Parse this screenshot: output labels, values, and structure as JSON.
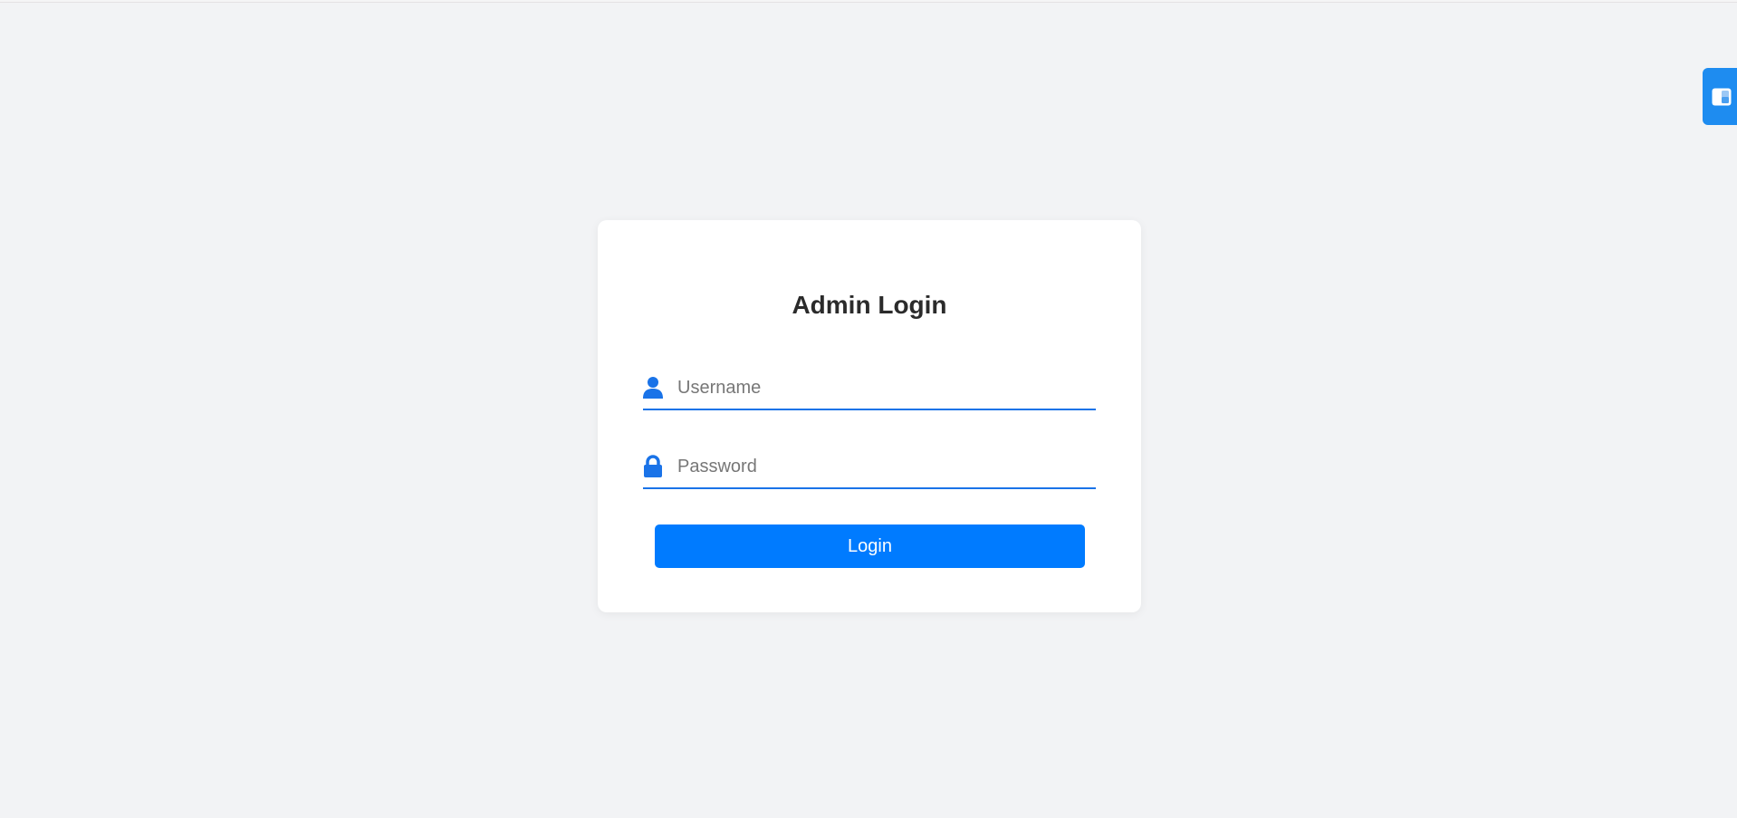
{
  "login": {
    "title": "Admin Login",
    "username": {
      "placeholder": "Username",
      "value": "",
      "icon": "user-icon"
    },
    "password": {
      "placeholder": "Password",
      "value": "",
      "icon": "lock-icon"
    },
    "submit_label": "Login"
  },
  "side_widget": {
    "icon": "panel-icon"
  },
  "colors": {
    "background": "#f2f3f5",
    "card": "#ffffff",
    "accent": "#007bff",
    "field_underline": "#1a73e8",
    "title_text": "#2b2b2b",
    "widget": "#1e8cf0"
  }
}
